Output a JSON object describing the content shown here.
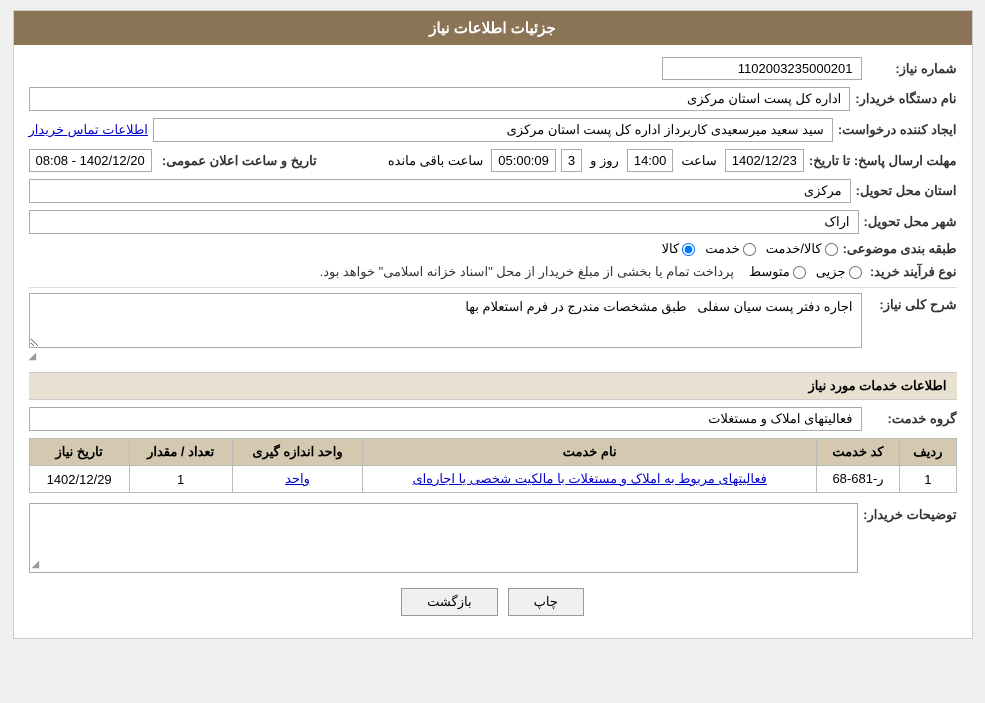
{
  "page": {
    "title": "جزئیات اطلاعات نیاز",
    "header": {
      "title": "جزئیات اطلاعات نیاز"
    }
  },
  "labels": {
    "request_number": "شماره نیاز:",
    "buyer_name": "نام دستگاه خریدار:",
    "creator": "ایجاد کننده درخواست:",
    "reply_deadline": "مهلت ارسال پاسخ: تا تاریخ:",
    "delivery_province": "استان محل تحویل:",
    "delivery_city": "شهر محل تحویل:",
    "category": "طبقه بندی موضوعی:",
    "purchase_type": "نوع فرآیند خرید:",
    "need_description": "شرح کلی نیاز:",
    "services_section": "اطلاعات خدمات مورد نیاز",
    "service_group_label": "گروه خدمت:",
    "buyer_desc": "توضیحات خریدار:",
    "date_time_label": "تاریخ و ساعت اعلان عمومی:",
    "remaining_time": "ساعت باقی مانده",
    "days": "روز و",
    "hour": "ساعت"
  },
  "values": {
    "request_number": "1102003235000201",
    "buyer_name": "اداره کل پست استان مرکزی",
    "creator_name": "سید سعید میرسعیدی کاربرداز اداره کل پست استان مرکزی",
    "creator_link": "اطلاعات تماس خریدار",
    "deadline_date": "1402/12/23",
    "deadline_hour": "14:00",
    "remaining_days": "3",
    "remaining_time": "05:00:09",
    "public_date": "1402/12/20 - 08:08",
    "delivery_province": "مرکزی",
    "delivery_city": "اراک",
    "category_goods": "کالا",
    "category_service": "خدمت",
    "category_goods_service": "کالا/خدمت",
    "purchase_partial": "جزیی",
    "purchase_medium": "متوسط",
    "purchase_note": "پرداخت تمام یا بخشی از مبلغ خریدار از محل \"اسناد خزانه اسلامی\" خواهد بود.",
    "need_description": "اجاره دفتر پست سیان سفلی   طبق مشخصات مندرج در فرم استعلام بها",
    "service_group": "فعالیتهای  املاک و مستغلات",
    "table_headers": {
      "row_num": "ردیف",
      "service_code": "کد خدمت",
      "service_name": "نام خدمت",
      "unit": "واحد اندازه گیری",
      "quantity": "تعداد / مقدار",
      "date": "تاریخ نیاز"
    },
    "table_rows": [
      {
        "row_num": "1",
        "service_code": "ر-681-68",
        "service_name": "فعالیتهای مربوط به املاک و مستغلات با مالکیت شخصی یا اجاره‌ای",
        "unit": "واحد",
        "quantity": "1",
        "date": "1402/12/29"
      }
    ]
  },
  "buttons": {
    "print": "چاپ",
    "back": "بازگشت"
  }
}
